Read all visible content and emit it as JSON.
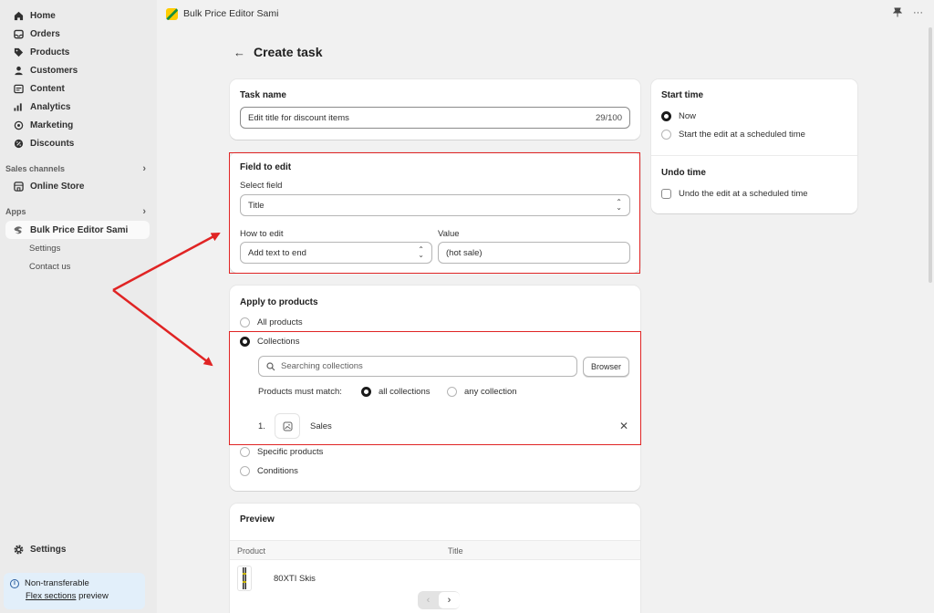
{
  "sidebar": {
    "nav": [
      {
        "label": "Home",
        "icon": "home-icon"
      },
      {
        "label": "Orders",
        "icon": "inbox-icon"
      },
      {
        "label": "Products",
        "icon": "tag-icon"
      },
      {
        "label": "Customers",
        "icon": "person-icon"
      },
      {
        "label": "Content",
        "icon": "content-icon"
      },
      {
        "label": "Analytics",
        "icon": "chart-icon"
      },
      {
        "label": "Marketing",
        "icon": "target-icon"
      },
      {
        "label": "Discounts",
        "icon": "discount-icon"
      }
    ],
    "sales_channels_label": "Sales channels",
    "online_store_label": "Online Store",
    "apps_label": "Apps",
    "active_app_label": "Bulk Price Editor Sami",
    "app_subitems": [
      "Settings",
      "Contact us"
    ],
    "settings_label": "Settings",
    "notice": {
      "title": "Non-transferable",
      "link": "Flex sections",
      "suffix": " preview"
    }
  },
  "topbar": {
    "app_name": "Bulk Price Editor Sami",
    "pin_icon": "pin-icon",
    "more_icon": "more-icon"
  },
  "page": {
    "title": "Create task"
  },
  "task_name": {
    "title": "Task name",
    "value": "Edit title for discount items",
    "counter": "29/100"
  },
  "field_to_edit": {
    "title": "Field to edit",
    "select_label": "Select field",
    "select_value": "Title",
    "how_label": "How to edit",
    "how_value": "Add text to end",
    "value_label": "Value",
    "value_value": "(hot sale)"
  },
  "apply": {
    "title": "Apply to products",
    "options": [
      "All products",
      "Collections",
      "Specific products",
      "Conditions"
    ],
    "selected": "Collections",
    "search_placeholder": "Searching collections",
    "browser_button": "Browser",
    "match_label": "Products must match:",
    "match_options": [
      "all collections",
      "any collection"
    ],
    "match_selected": "all collections",
    "items": [
      {
        "index": "1.",
        "name": "Sales"
      }
    ]
  },
  "preview": {
    "title": "Preview",
    "columns": [
      "Product",
      "Title"
    ],
    "rows": [
      {
        "product": "80XTI Skis",
        "title": ""
      }
    ]
  },
  "start_time": {
    "title": "Start time",
    "options": [
      "Now",
      "Start the edit at a scheduled time"
    ],
    "selected": "Now"
  },
  "undo_time": {
    "title": "Undo time",
    "checkbox_label": "Undo the edit at a scheduled time",
    "checked": false
  },
  "colors": {
    "annotation": "#e02424",
    "sidebar_bg": "#ebebeb",
    "main_bg": "#f1f1f1",
    "notice_bg": "#e2effa"
  }
}
